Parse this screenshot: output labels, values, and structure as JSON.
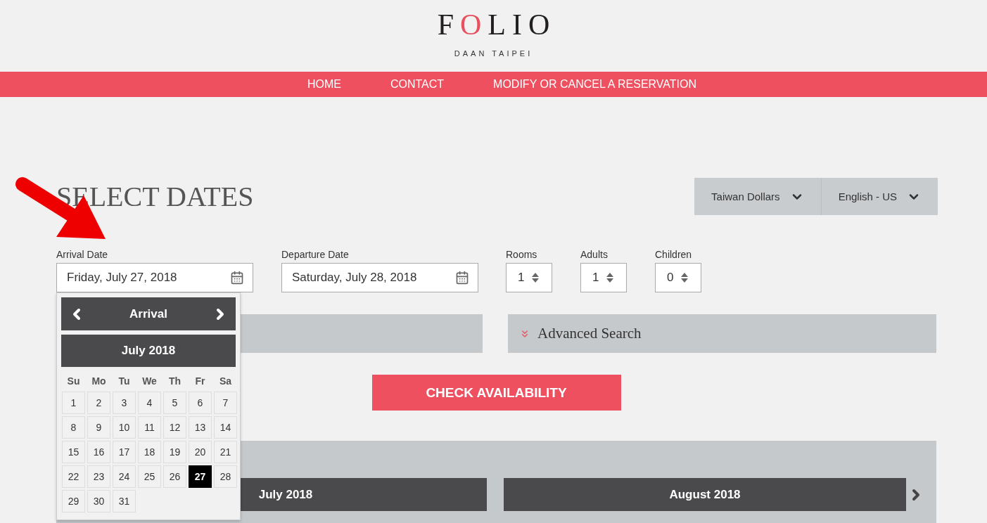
{
  "header": {
    "logo": [
      {
        "text": "F",
        "accent": false
      },
      {
        "text": "O",
        "accent": true
      },
      {
        "text": "LIO",
        "accent": false
      }
    ],
    "subtitle": "DAAN TAIPEI"
  },
  "nav": [
    "HOME",
    "CONTACT",
    "MODIFY OR CANCEL A RESERVATION"
  ],
  "title": "SELECT DATES",
  "selectors": [
    "Taiwan Dollars",
    "English - US"
  ],
  "dates": [
    {
      "label": "Arrival Date",
      "value": "Friday, July 27, 2018"
    },
    {
      "label": "Departure Date",
      "value": "Saturday, July 28, 2018"
    }
  ],
  "counters": [
    {
      "label": "Rooms",
      "value": "1"
    },
    {
      "label": "Adults",
      "value": "1"
    },
    {
      "label": "Children",
      "value": "0"
    }
  ],
  "advanced_search": "Advanced Search",
  "check_button": "CHECK AVAILABILITY",
  "datepicker": {
    "title": "Arrival",
    "month": "July 2018",
    "weekdays": [
      "Su",
      "Mo",
      "Tu",
      "We",
      "Th",
      "Fr",
      "Sa"
    ],
    "days": [
      {
        "label": "1",
        "selected": false
      },
      {
        "label": "2",
        "selected": false
      },
      {
        "label": "3",
        "selected": false
      },
      {
        "label": "4",
        "selected": false
      },
      {
        "label": "5",
        "selected": false
      },
      {
        "label": "6",
        "selected": false
      },
      {
        "label": "7",
        "selected": false
      },
      {
        "label": "8",
        "selected": false
      },
      {
        "label": "9",
        "selected": false
      },
      {
        "label": "10",
        "selected": false
      },
      {
        "label": "11",
        "selected": false
      },
      {
        "label": "12",
        "selected": false
      },
      {
        "label": "13",
        "selected": false
      },
      {
        "label": "14",
        "selected": false
      },
      {
        "label": "15",
        "selected": false
      },
      {
        "label": "16",
        "selected": false
      },
      {
        "label": "17",
        "selected": false
      },
      {
        "label": "18",
        "selected": false
      },
      {
        "label": "19",
        "selected": false
      },
      {
        "label": "20",
        "selected": false
      },
      {
        "label": "21",
        "selected": false
      },
      {
        "label": "22",
        "selected": false
      },
      {
        "label": "23",
        "selected": false
      },
      {
        "label": "24",
        "selected": false
      },
      {
        "label": "25",
        "selected": false
      },
      {
        "label": "26",
        "selected": false
      },
      {
        "label": "27",
        "selected": true
      },
      {
        "label": "28",
        "selected": false
      },
      {
        "label": "29",
        "selected": false
      },
      {
        "label": "30",
        "selected": false
      },
      {
        "label": "31",
        "selected": false
      }
    ]
  },
  "calendar_months": [
    "July 2018",
    "August 2018"
  ]
}
